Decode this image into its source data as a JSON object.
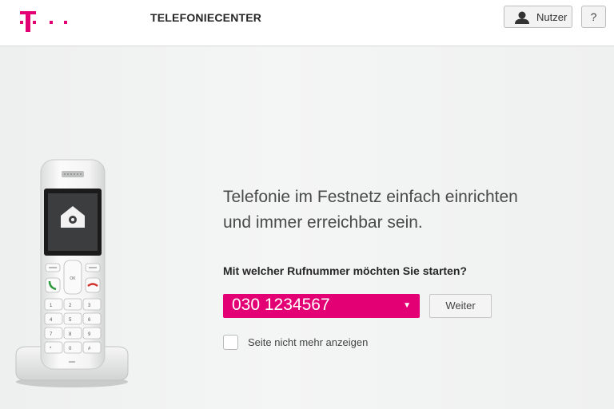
{
  "header": {
    "title": "TELEFONIECENTER",
    "user_button_label": "Nutzer",
    "help_button_label": "?"
  },
  "icons": {
    "logo": "telekom-t-logo",
    "user": "user-icon",
    "phone_screen": "home-settings-icon"
  },
  "phone_keys": [
    "1",
    "2",
    "3",
    "4",
    "5",
    "6",
    "7",
    "8",
    "9",
    "*",
    "0",
    "#",
    "OK"
  ],
  "colors": {
    "brand": "#e20074",
    "call_green": "#2e9a3c",
    "call_red": "#d0312d"
  },
  "main": {
    "headline_line1": "Telefonie im Festnetz einfach einrichten",
    "headline_line2": "und immer erreichbar sein.",
    "question": "Mit welcher Rufnummer möchten Sie starten?",
    "selected_number": "030 1234567",
    "next_button_label": "Weiter",
    "checkbox_label": "Seite nicht mehr anzeigen",
    "checkbox_checked": false
  }
}
